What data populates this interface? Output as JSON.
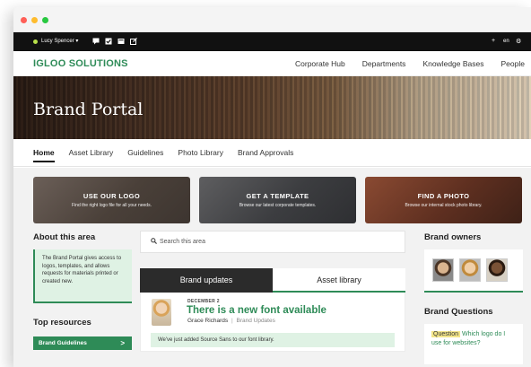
{
  "window": {
    "traffic_lights": [
      "close",
      "minimize",
      "zoom"
    ]
  },
  "topbar": {
    "user": "Lucy Spencer ▾",
    "icons": [
      "chat-icon",
      "check-icon",
      "inbox-icon",
      "edit-icon"
    ],
    "plus": "+",
    "lang": "en",
    "settings": "⚙"
  },
  "navbar": {
    "logo": "IGLOO SOLUTIONS",
    "links": [
      "Corporate Hub",
      "Departments",
      "Knowledge Bases",
      "People"
    ]
  },
  "hero": {
    "title": "Brand Portal"
  },
  "subnav": {
    "items": [
      "Home",
      "Asset Library",
      "Guidelines",
      "Photo Library",
      "Brand Approvals"
    ],
    "active": "Home"
  },
  "cta": [
    {
      "title": "USE OUR LOGO",
      "subtitle": "Find the right logo file for all your needs."
    },
    {
      "title": "GET A TEMPLATE",
      "subtitle": "Browse our latest corporate templates."
    },
    {
      "title": "FIND A PHOTO",
      "subtitle": "Browse our internal stock photo library."
    }
  ],
  "about": {
    "title": "About this area",
    "text": "The Brand Portal gives access to logos, templates, and allows requests for materials printed or created new."
  },
  "resources": {
    "title": "Top resources",
    "button": "Brand Guidelines",
    "chevron": ">"
  },
  "search": {
    "icon": "🔍",
    "placeholder": "Search this area"
  },
  "tabs": [
    "Brand updates",
    "Asset library"
  ],
  "post": {
    "date": "DECEMBER 2",
    "title": "There is a new font available",
    "author": "Grace Richards",
    "separator": "|",
    "category": "Brand Updates",
    "body": "We've just added Source Sans to our font library."
  },
  "owners": {
    "title": "Brand owners"
  },
  "questions": {
    "title": "Brand Questions",
    "tag": "Question",
    "text": "Which logo do I use for websites?"
  },
  "colors": {
    "brand_green": "#2e8b57",
    "topbar": "#111111",
    "light_green": "#dff2e4",
    "question_tag": "#f3e58a"
  }
}
